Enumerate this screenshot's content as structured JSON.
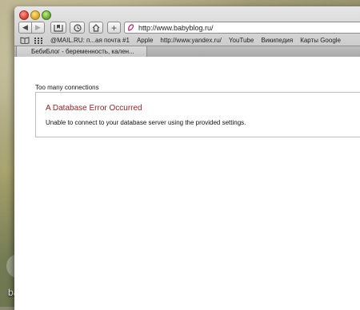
{
  "desktop": {
    "label": "ba"
  },
  "browser": {
    "url": "http://www.babyblog.ru/",
    "bookmarks": [
      "@MAIL.RU: п...ая почта #1",
      "Apple",
      "http://www.yandex.ru/",
      "YouTube",
      "Википедия",
      "Карты Google"
    ],
    "tab_title": "БебиБлог - беременность, кален..."
  },
  "page": {
    "title": "Too many connections",
    "error_heading": "A Database Error Occurred",
    "error_message": "Unable to connect to your database server using the provided settings."
  },
  "colors": {
    "error_heading": "#9b1d1d",
    "favicon": "#c2187a"
  }
}
